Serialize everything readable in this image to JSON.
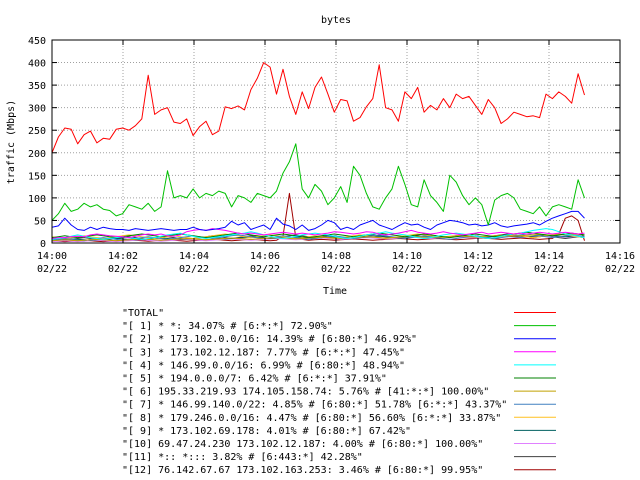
{
  "chart_data": {
    "type": "line",
    "title": "bytes",
    "xlabel": "Time",
    "ylabel": "traffic (Mbps)",
    "ylim": [
      0,
      450
    ],
    "yticks": [
      "0",
      "50",
      "100",
      "150",
      "200",
      "250",
      "300",
      "350",
      "400",
      "450"
    ],
    "xlim": [
      "14:00 02/22",
      "14:16 02/22"
    ],
    "xticks": [
      {
        "time": "14:00",
        "date": "02/22"
      },
      {
        "time": "14:02",
        "date": "02/22"
      },
      {
        "time": "14:04",
        "date": "02/22"
      },
      {
        "time": "14:06",
        "date": "02/22"
      },
      {
        "time": "14:08",
        "date": "02/22"
      },
      {
        "time": "14:10",
        "date": "02/22"
      },
      {
        "time": "14:12",
        "date": "02/22"
      },
      {
        "time": "14:14",
        "date": "02/22"
      },
      {
        "time": "14:16",
        "date": "02/22"
      }
    ],
    "grid": true,
    "legend_position": "bottom",
    "x_start": "14:00",
    "x_end": "14:15",
    "series": [
      {
        "name": "\"TOTAL\"",
        "color": "#ff0000",
        "values": [
          200,
          235,
          255,
          252,
          220,
          240,
          248,
          222,
          232,
          230,
          252,
          255,
          250,
          260,
          275,
          372,
          285,
          295,
          300,
          268,
          265,
          275,
          238,
          258,
          270,
          240,
          248,
          302,
          298,
          304,
          295,
          340,
          365,
          400,
          390,
          330,
          385,
          325,
          285,
          335,
          298,
          345,
          368,
          330,
          290,
          318,
          315,
          270,
          278,
          302,
          320,
          395,
          300,
          295,
          270,
          335,
          320,
          345,
          290,
          305,
          295,
          320,
          300,
          330,
          320,
          325,
          305,
          285,
          318,
          300,
          265,
          275,
          290,
          285,
          280,
          282,
          278,
          330,
          320,
          335,
          325,
          310,
          375,
          328
        ]
      },
      {
        "name": "\"[ 1] * *: 34.07% # [6:*:*] 72.90%\"",
        "color": "#00c000",
        "values": [
          50,
          65,
          88,
          70,
          75,
          88,
          80,
          85,
          75,
          72,
          60,
          65,
          85,
          80,
          75,
          88,
          70,
          80,
          160,
          100,
          105,
          100,
          120,
          100,
          110,
          105,
          115,
          110,
          80,
          105,
          100,
          90,
          110,
          105,
          100,
          115,
          155,
          180,
          220,
          120,
          100,
          130,
          115,
          85,
          100,
          125,
          90,
          170,
          150,
          110,
          80,
          75,
          100,
          120,
          170,
          130,
          85,
          80,
          140,
          105,
          90,
          70,
          150,
          135,
          105,
          85,
          100,
          85,
          40,
          95,
          105,
          110,
          100,
          75,
          70,
          65,
          80,
          60,
          80,
          85,
          80,
          75,
          140,
          100
        ]
      },
      {
        "name": "\"[ 2] * 173.102.0.0/16: 14.39% # [6:80:*] 46.92%\"",
        "color": "#0000ff",
        "values": [
          35,
          38,
          55,
          40,
          30,
          28,
          35,
          30,
          35,
          32,
          30,
          30,
          28,
          32,
          30,
          28,
          30,
          32,
          30,
          28,
          30,
          30,
          35,
          30,
          28,
          30,
          32,
          35,
          48,
          40,
          45,
          30,
          35,
          40,
          30,
          55,
          42,
          38,
          30,
          40,
          28,
          32,
          40,
          50,
          45,
          30,
          35,
          30,
          40,
          45,
          50,
          40,
          35,
          30,
          38,
          45,
          40,
          42,
          35,
          30,
          40,
          45,
          50,
          48,
          45,
          40,
          42,
          38,
          40,
          45,
          38,
          35,
          38,
          40,
          42,
          45,
          40,
          48,
          55,
          60,
          65,
          70,
          70,
          55
        ]
      },
      {
        "name": "\"[ 3] * 173.102.12.187: 7.77% # [6:*:*] 47.45%\"",
        "color": "#ff00ff",
        "values": [
          10,
          12,
          12,
          14,
          15,
          14,
          18,
          20,
          18,
          16,
          15,
          14,
          12,
          15,
          18,
          20,
          18,
          20,
          16,
          15,
          18,
          25,
          28,
          30,
          28,
          32,
          30,
          28,
          25,
          22,
          20,
          22,
          20,
          18,
          20,
          22,
          24,
          22,
          20,
          22,
          20,
          18,
          20,
          22,
          25,
          24,
          22,
          20,
          22,
          25,
          24,
          20,
          18,
          20,
          22,
          25,
          28,
          24,
          22,
          20,
          22,
          25,
          22,
          20,
          18,
          20,
          22,
          24,
          20,
          22,
          24,
          22,
          20,
          22,
          20,
          22,
          24,
          22,
          20,
          22,
          24,
          22,
          20,
          22
        ]
      },
      {
        "name": "\"[ 4] * 146.99.0.0/16: 6.99% # [6:80:*] 48.94%\"",
        "color": "#00ffff",
        "values": [
          8,
          10,
          12,
          15,
          18,
          15,
          12,
          10,
          8,
          10,
          12,
          14,
          12,
          10,
          8,
          10,
          12,
          15,
          18,
          20,
          22,
          18,
          15,
          12,
          10,
          12,
          14,
          16,
          18,
          20,
          22,
          25,
          22,
          18,
          15,
          12,
          10,
          12,
          15,
          18,
          20,
          22,
          20,
          18,
          15,
          12,
          10,
          12,
          15,
          18,
          20,
          22,
          25,
          22,
          20,
          18,
          15,
          12,
          10,
          12,
          15,
          18,
          20,
          22,
          20,
          18,
          15,
          12,
          10,
          12,
          15,
          18,
          20,
          22,
          25,
          28,
          30,
          32,
          30,
          25,
          20,
          18,
          15,
          12
        ]
      },
      {
        "name": "\"[ 5] * 194.0.0.0/7: 6.42% # [6:*:*] 37.91%\"",
        "color": "#008000",
        "values": [
          12,
          14,
          16,
          14,
          12,
          14,
          16,
          18,
          16,
          14,
          12,
          14,
          16,
          18,
          20,
          18,
          16,
          14,
          16,
          18,
          20,
          18,
          16,
          14,
          12,
          14,
          16,
          18,
          20,
          22,
          20,
          18,
          16,
          14,
          16,
          18,
          20,
          18,
          16,
          14,
          12,
          14,
          16,
          18,
          20,
          18,
          16,
          14,
          16,
          18,
          20,
          22,
          20,
          18,
          16,
          14,
          16,
          18,
          20,
          18,
          16,
          14,
          12,
          14,
          16,
          18,
          20,
          18,
          16,
          14,
          16,
          18,
          20,
          22,
          24,
          22,
          20,
          18,
          16,
          18,
          20,
          22,
          20,
          18
        ]
      },
      {
        "name": "\"[ 6] 195.33.219.93 174.105.158.74: 5.76% # [41:*:*] 100.00%\"",
        "color": "#c0a000",
        "values": [
          5,
          6,
          7,
          6,
          5,
          6,
          7,
          8,
          7,
          6,
          5,
          6,
          7,
          8,
          9,
          8,
          7,
          6,
          7,
          8,
          9,
          10,
          9,
          8,
          7,
          8,
          9,
          10,
          11,
          10,
          9,
          8,
          9,
          10,
          11,
          12,
          11,
          10,
          9,
          10,
          11,
          12,
          13,
          12,
          11,
          10,
          11,
          12,
          13,
          14,
          13,
          12,
          11,
          12,
          13,
          14,
          15,
          14,
          13,
          12,
          13,
          14,
          15,
          16,
          15,
          14,
          13,
          14,
          15,
          16,
          17,
          16,
          15,
          16,
          17,
          18,
          19,
          18,
          17,
          18,
          19,
          20,
          19,
          18
        ]
      },
      {
        "name": "\"[ 7] * 146.99.140.0/22: 4.85% # [6:80:*] 51.78% [6:*:*] 43.37%\"",
        "color": "#4080c0",
        "values": [
          5,
          8,
          10,
          8,
          6,
          5,
          8,
          10,
          12,
          10,
          8,
          6,
          8,
          10,
          12,
          14,
          12,
          10,
          8,
          10,
          12,
          14,
          16,
          14,
          12,
          10,
          12,
          14,
          16,
          18,
          16,
          14,
          12,
          10,
          12,
          14,
          16,
          14,
          12,
          10,
          8,
          10,
          12,
          14,
          16,
          14,
          12,
          10,
          12,
          14,
          16,
          18,
          16,
          14,
          12,
          10,
          12,
          14,
          16,
          14,
          12,
          10,
          8,
          10,
          12,
          14,
          16,
          14,
          12,
          10,
          12,
          14,
          16,
          18,
          20,
          18,
          16,
          14,
          12,
          14,
          16,
          18,
          16,
          14
        ]
      },
      {
        "name": "\"[ 8] * 179.246.0.0/16: 4.47% # [6:80:*] 56.60% [6:*:*] 33.87%\"",
        "color": "#ffc020",
        "values": [
          14,
          12,
          10,
          12,
          14,
          16,
          14,
          12,
          10,
          12,
          14,
          16,
          18,
          16,
          14,
          12,
          10,
          12,
          14,
          16,
          14,
          12,
          10,
          12,
          14,
          16,
          18,
          20,
          18,
          16,
          14,
          12,
          14,
          16,
          18,
          16,
          14,
          12,
          10,
          12,
          14,
          16,
          14,
          12,
          10,
          12,
          14,
          16,
          18,
          16,
          14,
          12,
          10,
          12,
          14,
          16,
          18,
          20,
          18,
          16,
          14,
          12,
          14,
          16,
          18,
          16,
          14,
          12,
          10,
          12,
          14,
          16,
          18,
          16,
          14,
          12,
          14,
          16,
          18,
          20,
          18,
          16,
          14,
          12
        ]
      },
      {
        "name": "\"[ 9] * 173.102.69.178: 4.01% # [6:80:*] 67.42%\"",
        "color": "#006060",
        "values": [
          6,
          7,
          8,
          9,
          8,
          7,
          6,
          7,
          8,
          9,
          10,
          9,
          8,
          7,
          8,
          9,
          10,
          11,
          10,
          9,
          8,
          9,
          10,
          11,
          12,
          11,
          10,
          9,
          10,
          11,
          12,
          13,
          12,
          11,
          10,
          11,
          12,
          13,
          14,
          13,
          12,
          11,
          12,
          13,
          14,
          13,
          12,
          11,
          12,
          13,
          14,
          15,
          14,
          13,
          12,
          13,
          14,
          15,
          14,
          13,
          12,
          13,
          14,
          15,
          16,
          15,
          14,
          13,
          14,
          15,
          16,
          15,
          14,
          13,
          14,
          15,
          16,
          17,
          16,
          15,
          14,
          15,
          16,
          15
        ]
      },
      {
        "name": "\"[10] 69.47.24.230 173.102.12.187: 4.00% # [6:80:*] 100.00%\"",
        "color": "#e080ff",
        "values": [
          3,
          4,
          5,
          4,
          3,
          4,
          5,
          6,
          5,
          4,
          3,
          4,
          5,
          6,
          7,
          6,
          5,
          4,
          5,
          6,
          7,
          8,
          7,
          6,
          5,
          6,
          7,
          8,
          9,
          8,
          7,
          6,
          7,
          8,
          9,
          10,
          9,
          8,
          7,
          8,
          9,
          10,
          11,
          10,
          9,
          8,
          9,
          10,
          11,
          12,
          11,
          10,
          9,
          10,
          11,
          12,
          13,
          12,
          11,
          10,
          11,
          12,
          13,
          14,
          13,
          12,
          11,
          12,
          13,
          14,
          15,
          14,
          13,
          12,
          13,
          14,
          15,
          16,
          15,
          14,
          13,
          14,
          15,
          14
        ]
      },
      {
        "name": "\"[11] *:: *::: 3.82% # [6:443:*] 42.28%\"",
        "color": "#404040",
        "values": [
          10,
          8,
          6,
          8,
          10,
          12,
          10,
          8,
          6,
          8,
          10,
          12,
          14,
          12,
          10,
          8,
          10,
          12,
          14,
          12,
          10,
          8,
          10,
          12,
          14,
          16,
          14,
          12,
          10,
          12,
          14,
          16,
          14,
          12,
          10,
          12,
          14,
          16,
          18,
          16,
          14,
          12,
          14,
          16,
          14,
          12,
          10,
          12,
          14,
          16,
          18,
          16,
          14,
          12,
          10,
          12,
          14,
          16,
          14,
          12,
          10,
          12,
          14,
          16,
          18,
          16,
          14,
          12,
          14,
          16,
          18,
          20,
          18,
          16,
          14,
          12,
          14,
          16,
          14,
          12,
          10,
          12,
          14,
          12
        ]
      },
      {
        "name": "\"[12] 76.142.67.67 173.102.163.253: 3.46% # [6:80:*] 99.95%\"",
        "color": "#a00000",
        "values": [
          5,
          4,
          3,
          4,
          5,
          6,
          5,
          4,
          3,
          4,
          5,
          6,
          7,
          6,
          5,
          4,
          5,
          6,
          7,
          6,
          5,
          4,
          5,
          6,
          7,
          8,
          7,
          6,
          5,
          6,
          7,
          8,
          7,
          6,
          5,
          6,
          15,
          110,
          12,
          8,
          6,
          7,
          8,
          7,
          6,
          7,
          8,
          9,
          8,
          7,
          6,
          7,
          8,
          9,
          10,
          9,
          8,
          7,
          8,
          9,
          10,
          9,
          8,
          7,
          8,
          9,
          10,
          11,
          10,
          9,
          8,
          9,
          10,
          11,
          10,
          9,
          8,
          9,
          10,
          20,
          55,
          60,
          50,
          5
        ]
      }
    ]
  }
}
